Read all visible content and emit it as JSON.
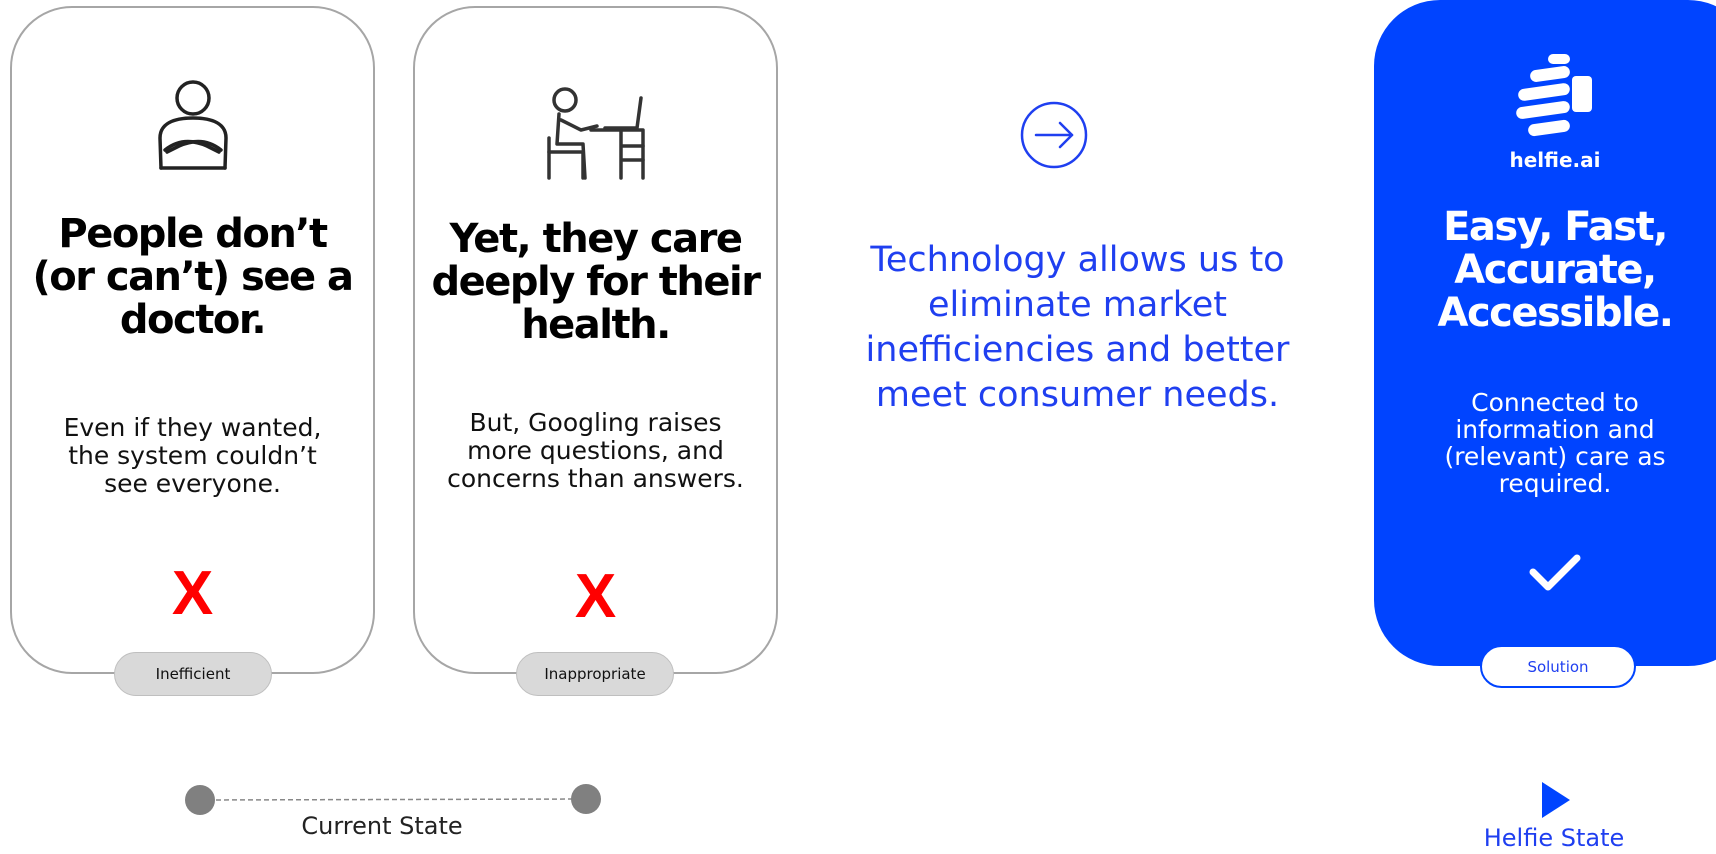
{
  "cards": [
    {
      "headline": "People don’t\n(or can’t) see a\ndoctor.",
      "body": "Even if they wanted,\nthe system couldn’t\nsee everyone.",
      "mark": "X",
      "tag": "Inefficient"
    },
    {
      "headline": "Yet, they care\ndeeply for their\nhealth.",
      "body": "But, Googling raises\nmore questions, and\nconcerns than answers.",
      "mark": "X",
      "tag": "Inappropriate"
    }
  ],
  "transition": {
    "icon": "arrow-right-circle-icon",
    "text": "Technology allows us to\neliminate market\ninefficiencies and better\nmeet consumer needs."
  },
  "solution": {
    "logo_text": "helfie.ai",
    "headline": "Easy, Fast,\nAccurate,\nAccessible.",
    "body": "Connected to\ninformation and\n(relevant) care as\nrequired.",
    "mark_icon": "checkmark-icon",
    "tag": "Solution"
  },
  "timeline": {
    "current_label": "Current State",
    "helfie_label": "Helfie State"
  },
  "colors": {
    "brand_blue": "#0044ff",
    "text_blue": "#1f3ff0",
    "negative_red": "#ff0000",
    "card_border": "#a6a6a6",
    "pill_gray": "#d9d9d9"
  }
}
